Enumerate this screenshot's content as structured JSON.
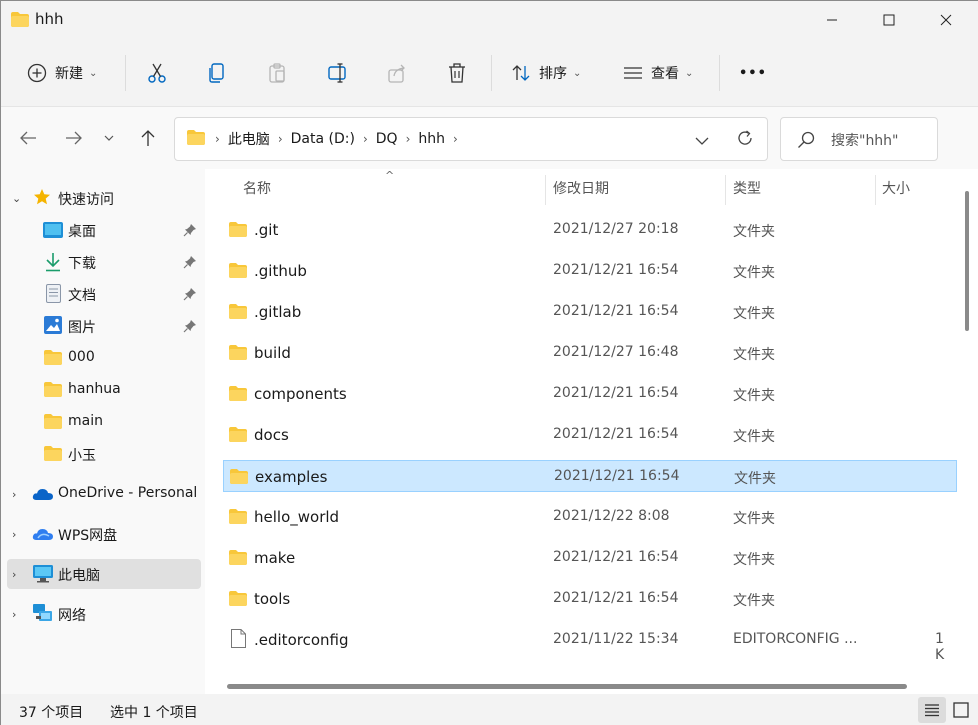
{
  "window": {
    "title": "hhh"
  },
  "toolbar": {
    "new_label": "新建",
    "sort_label": "排序",
    "view_label": "查看",
    "more_label": "•••"
  },
  "address": {
    "crumbs": [
      "此电脑",
      "Data (D:)",
      "DQ",
      "hhh"
    ]
  },
  "search": {
    "placeholder": "搜索\"hhh\""
  },
  "sidebar": {
    "quick_access": "快速访问",
    "items": [
      "桌面",
      "下载",
      "文档",
      "图片",
      "000",
      "hanhua",
      "main",
      "小玉"
    ],
    "onedrive": "OneDrive - Personal",
    "wps": "WPS网盘",
    "this_pc": "此电脑",
    "network": "网络"
  },
  "columns": {
    "name": "名称",
    "date": "修改日期",
    "type": "类型",
    "size": "大小"
  },
  "files": [
    {
      "name": ".git",
      "date": "2021/12/27 20:18",
      "type": "文件夹",
      "size": ""
    },
    {
      "name": ".github",
      "date": "2021/12/21 16:54",
      "type": "文件夹",
      "size": ""
    },
    {
      "name": ".gitlab",
      "date": "2021/12/21 16:54",
      "type": "文件夹",
      "size": ""
    },
    {
      "name": "build",
      "date": "2021/12/27 16:48",
      "type": "文件夹",
      "size": ""
    },
    {
      "name": "components",
      "date": "2021/12/21 16:54",
      "type": "文件夹",
      "size": ""
    },
    {
      "name": "docs",
      "date": "2021/12/21 16:54",
      "type": "文件夹",
      "size": ""
    },
    {
      "name": "examples",
      "date": "2021/12/21 16:54",
      "type": "文件夹",
      "size": ""
    },
    {
      "name": "hello_world",
      "date": "2021/12/22 8:08",
      "type": "文件夹",
      "size": ""
    },
    {
      "name": "make",
      "date": "2021/12/21 16:54",
      "type": "文件夹",
      "size": ""
    },
    {
      "name": "tools",
      "date": "2021/12/21 16:54",
      "type": "文件夹",
      "size": ""
    },
    {
      "name": ".editorconfig",
      "date": "2021/11/22 15:34",
      "type": "EDITORCONFIG ...",
      "size": "1 K"
    }
  ],
  "status": {
    "count": "37 个项目",
    "selected": "选中 1 个项目"
  },
  "colors": {
    "folder": "#f8c73a",
    "selection": "#cce8ff",
    "accent": "#0067c0"
  }
}
